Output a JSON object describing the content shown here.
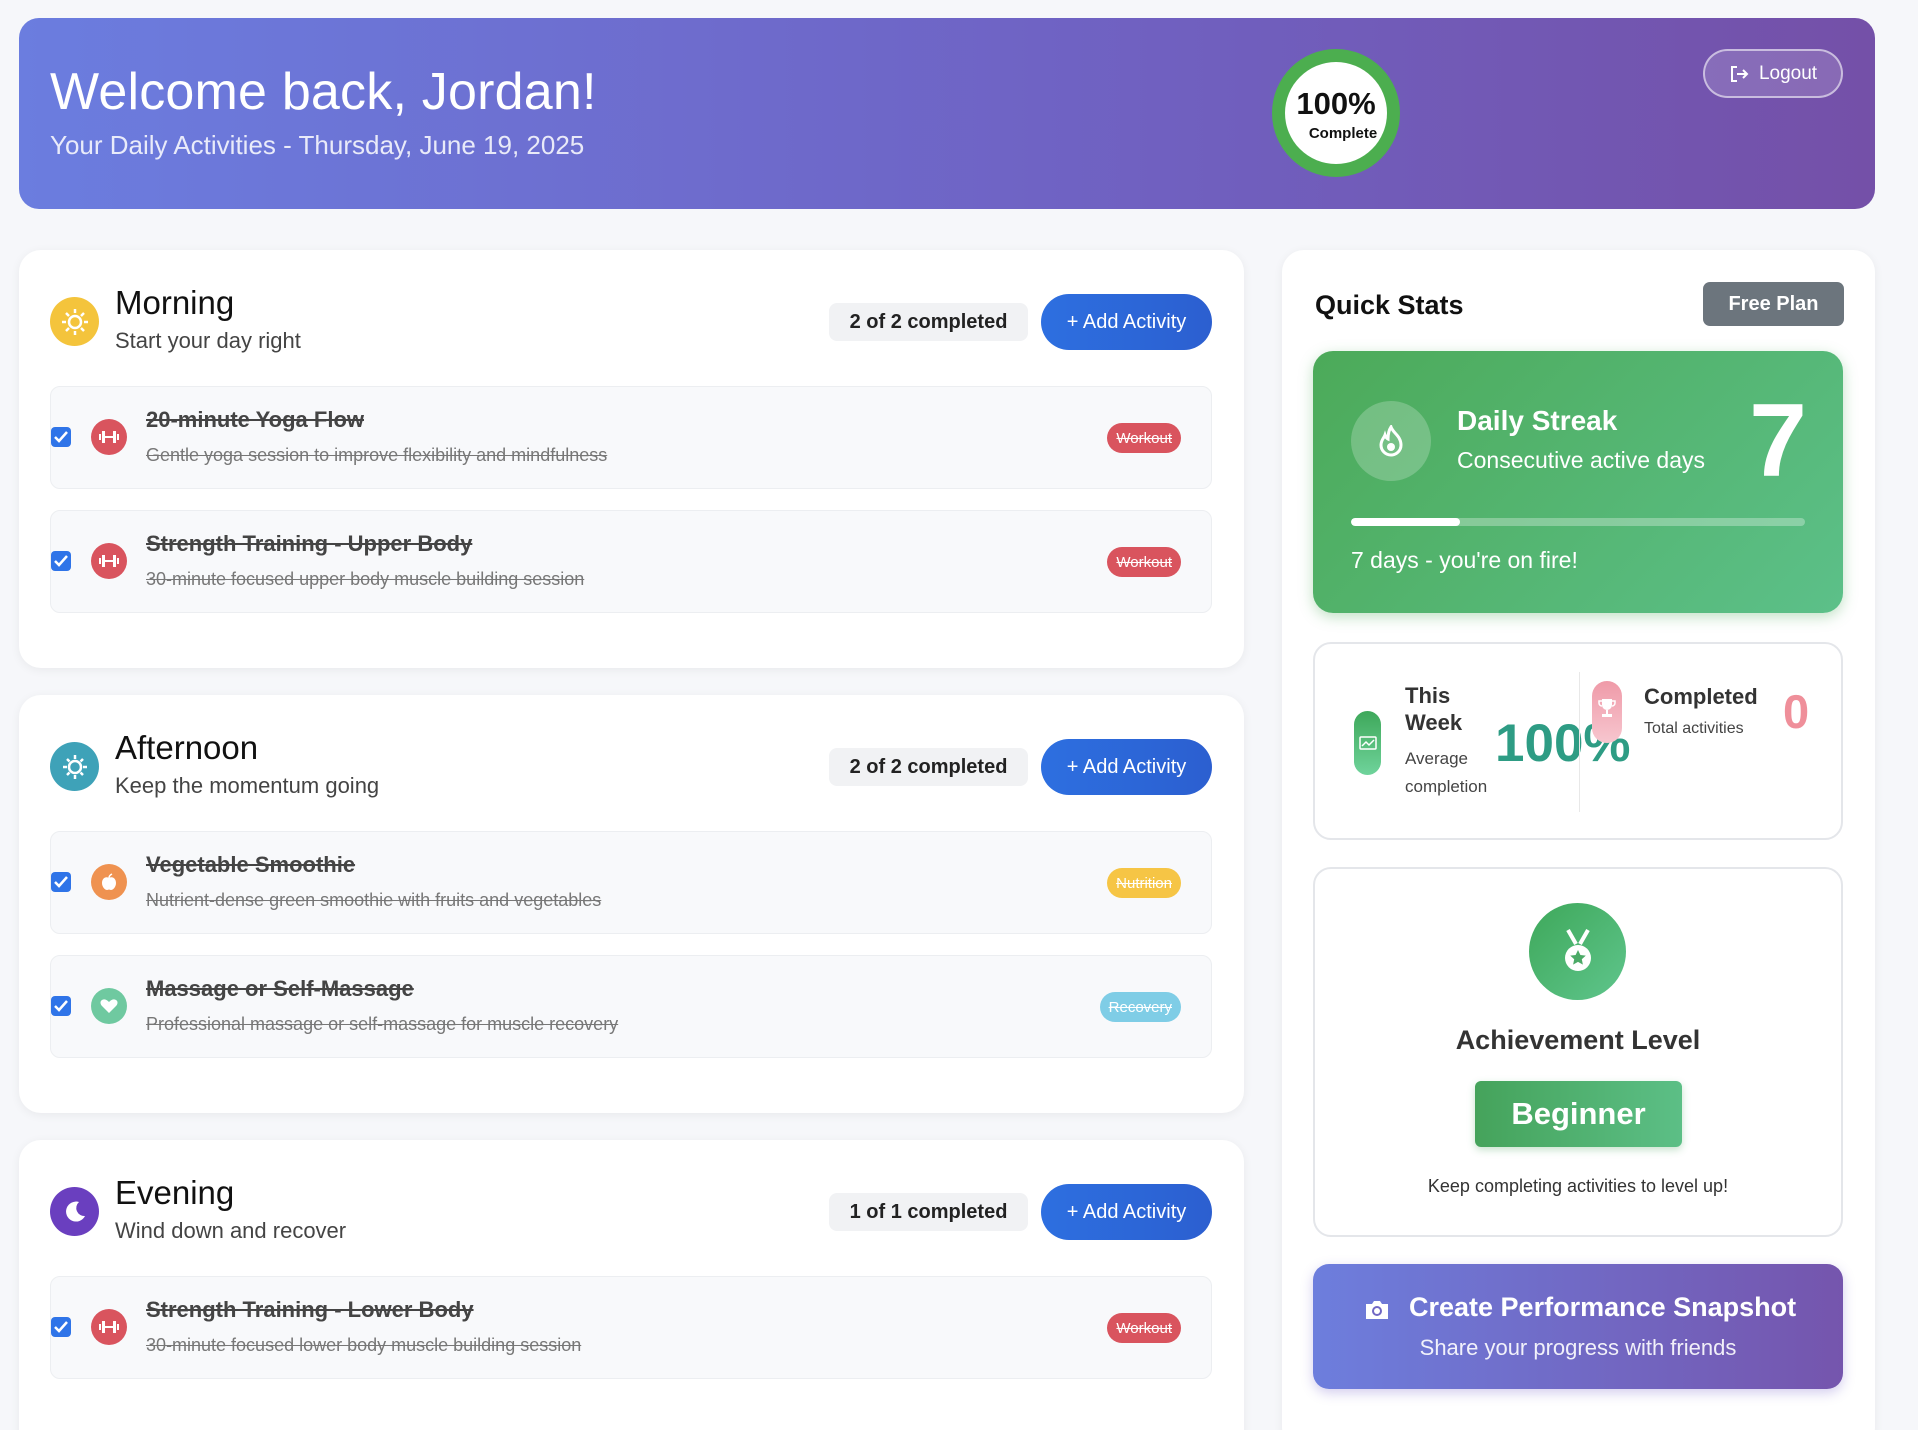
{
  "header": {
    "welcome": "Welcome back, Jordan!",
    "subtitle": "Your Daily Activities - Thursday, June 19, 2025",
    "progress_value": "100%",
    "progress_label": "Complete",
    "logout_label": "Logout"
  },
  "sections": [
    {
      "title": "Morning",
      "subtitle": "Start your day right",
      "completed": "2 of 2 completed",
      "add_label": "+ Add Activity",
      "activities": [
        {
          "title": "20-minute Yoga Flow",
          "description": "Gentle yoga session to improve flexibility and mindfulness",
          "tag": "Workout",
          "checked": true,
          "icon": "dumbbell-icon"
        },
        {
          "title": "Strength Training - Upper Body",
          "description": "30-minute focused upper body muscle building session",
          "tag": "Workout",
          "checked": true,
          "icon": "dumbbell-icon"
        }
      ]
    },
    {
      "title": "Afternoon",
      "subtitle": "Keep the momentum going",
      "completed": "2 of 2 completed",
      "add_label": "+ Add Activity",
      "activities": [
        {
          "title": "Vegetable Smoothie",
          "description": "Nutrient-dense green smoothie with fruits and vegetables",
          "tag": "Nutrition",
          "checked": true,
          "icon": "apple-icon"
        },
        {
          "title": "Massage or Self-Massage",
          "description": "Professional massage or self-massage for muscle recovery",
          "tag": "Recovery",
          "checked": true,
          "icon": "heart-hand-icon"
        }
      ]
    },
    {
      "title": "Evening",
      "subtitle": "Wind down and recover",
      "completed": "1 of 1 completed",
      "add_label": "+ Add Activity",
      "activities": [
        {
          "title": "Strength Training - Lower Body",
          "description": "30-minute focused lower body muscle building session",
          "tag": "Workout",
          "checked": true,
          "icon": "dumbbell-icon"
        }
      ]
    }
  ],
  "quick_stats": {
    "title": "Quick Stats",
    "plan": "Free Plan",
    "streak": {
      "title": "Daily Streak",
      "subtitle": "Consecutive active days",
      "value": "7",
      "progress": 0.24,
      "message": "7 days - you're on fire!"
    },
    "week": {
      "title": "This Week",
      "subtitle": "Average completion",
      "value": "100%"
    },
    "completed": {
      "title": "Completed",
      "subtitle": "Total activities",
      "value": "0"
    },
    "achievement": {
      "title": "Achievement Level",
      "level": "Beginner",
      "subtitle": "Keep completing activities to level up!"
    },
    "snapshot": {
      "title": "Create Performance Snapshot",
      "subtitle": "Share your progress with friends"
    }
  },
  "colors": {
    "header_gradient_start": "#6b7ddf",
    "header_gradient_end": "#7450a8",
    "accent_blue": "#2d6fe0",
    "success_green": "#4cae4f",
    "workout_tag": "#d9545e",
    "nutrition_tag": "#f6c545",
    "recovery_tag": "#7fcde6"
  }
}
